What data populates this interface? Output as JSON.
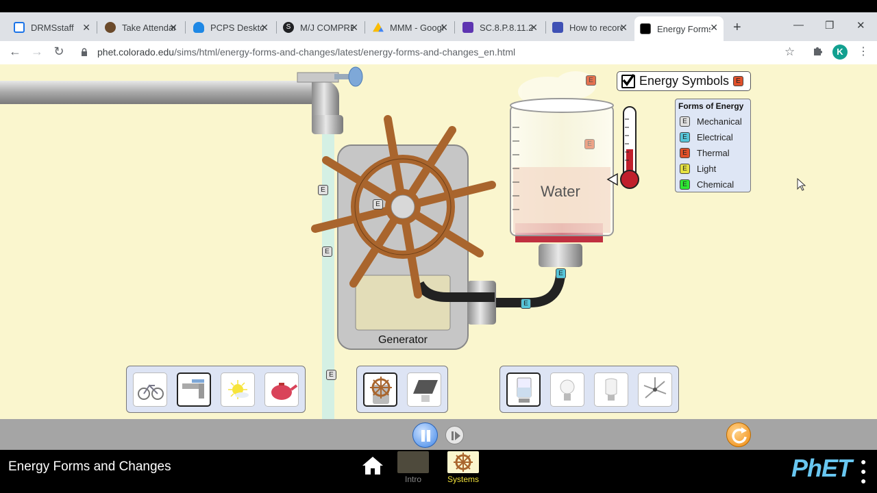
{
  "browser": {
    "tabs": [
      {
        "label": "DRMSstaff",
        "icon_color": "#1a73e8"
      },
      {
        "label": "Take Attendance",
        "icon_color": "#6b4a2b"
      },
      {
        "label": "PCPS Desktop",
        "icon_color": "#1e88e5"
      },
      {
        "label": "M/J COMPREHENSIVE",
        "icon_color": "#202124"
      },
      {
        "label": "MMM - Google Drive",
        "icon_color": "#fbbc04"
      },
      {
        "label": "SC.8.P.8.11.2",
        "icon_color": "#5e35b1"
      },
      {
        "label": "How to record",
        "icon_color": "#3f51b5"
      },
      {
        "label": "Energy Forms",
        "icon_color": "#000000"
      }
    ],
    "new_tab": "+",
    "url_host": "phet.colorado.edu",
    "url_path": "/sims/html/energy-forms-and-changes/latest/energy-forms-and-changes_en.html",
    "profile_initial": "K"
  },
  "sim": {
    "energy_symbols_label": "Energy Symbols",
    "energy_symbols_checked": true,
    "chip_letter": "E",
    "legend": {
      "title": "Forms of Energy",
      "items": [
        {
          "label": "Mechanical",
          "color": "#e0e0e0"
        },
        {
          "label": "Electrical",
          "color": "#56c5d9"
        },
        {
          "label": "Thermal",
          "color": "#e0502a"
        },
        {
          "label": "Light",
          "color": "#e6e242"
        },
        {
          "label": "Chemical",
          "color": "#2ee833"
        }
      ]
    },
    "generator_label": "Generator",
    "beaker_label": "Water",
    "sources": [
      "bicycle-icon",
      "faucet-icon",
      "sun-icon",
      "teapot-icon"
    ],
    "selected_source": "faucet-icon",
    "converters": [
      "water-wheel-generator-icon",
      "solar-panel-icon"
    ],
    "selected_converter": "water-wheel-generator-icon",
    "users": [
      "beaker-heater-icon",
      "incandescent-bulb-icon",
      "fluorescent-bulb-icon",
      "fan-icon"
    ],
    "selected_user": "beaker-heater-icon"
  },
  "footer": {
    "sim_title": "Energy Forms and Changes",
    "screens": [
      {
        "label": "Intro",
        "selected": false
      },
      {
        "label": "Systems",
        "selected": true
      }
    ],
    "logo": "PhET"
  }
}
